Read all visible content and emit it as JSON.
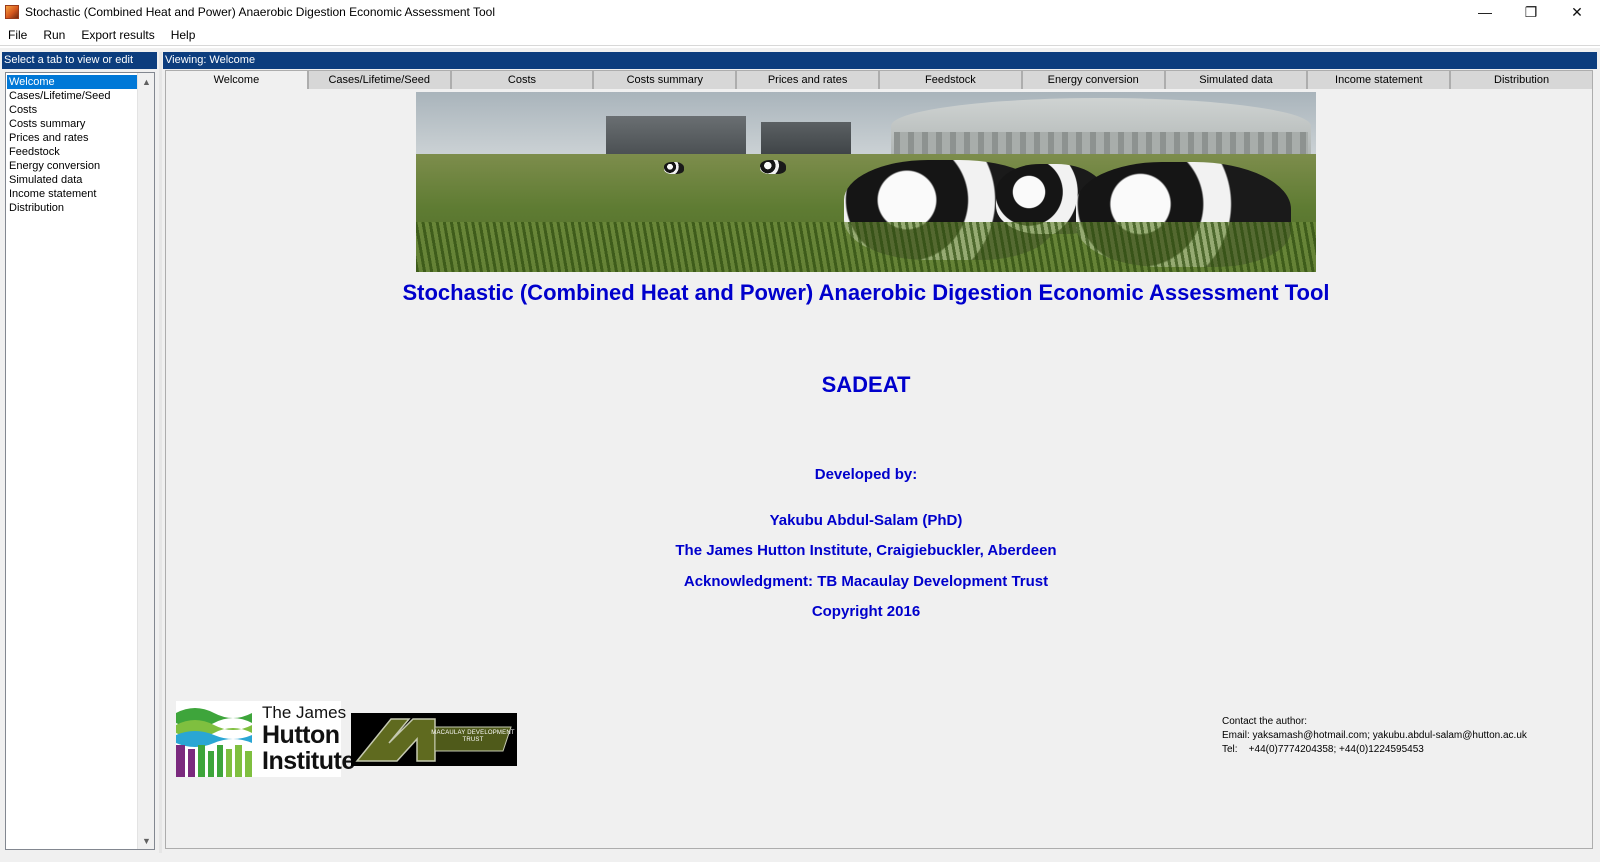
{
  "window": {
    "title": "Stochastic (Combined Heat and Power) Anaerobic Digestion Economic Assessment Tool",
    "controls": {
      "minimize": "—",
      "restore": "❐",
      "close": "✕"
    }
  },
  "menu": [
    "File",
    "Run",
    "Export results",
    "Help"
  ],
  "sidebar": {
    "header": "Select a tab to view or edit",
    "items": [
      "Welcome",
      "Cases/Lifetime/Seed",
      "Costs",
      "Costs summary",
      "Prices and rates",
      "Feedstock",
      "Energy conversion",
      "Simulated data",
      "Income statement",
      "Distribution"
    ],
    "selected_index": 0
  },
  "viewing": "Viewing: Welcome",
  "tabs": [
    "Welcome",
    "Cases/Lifetime/Seed",
    "Costs",
    "Costs summary",
    "Prices and rates",
    "Feedstock",
    "Energy conversion",
    "Simulated data",
    "Income statement",
    "Distribution"
  ],
  "active_tab": "Welcome",
  "welcome": {
    "title": "Stochastic (Combined Heat and Power) Anaerobic Digestion Economic Assessment Tool",
    "acronym": "SADEAT",
    "developed_by": "Developed by:",
    "author": "Yakubu Abdul-Salam (PhD)",
    "institution": "The James Hutton Institute, Craigiebuckler, Aberdeen",
    "acknowledgment": "Acknowledgment: TB Macaulay Development Trust",
    "copyright": "Copyright 2016",
    "text_color": "#0000CC"
  },
  "logos": {
    "hutton": {
      "line1": "The James",
      "line2": "Hutton",
      "line3": "Institute"
    },
    "macaulay": {
      "line1": "MACAULAY DEVELOPMENT",
      "line2": "TRUST"
    }
  },
  "contact": {
    "heading": "Contact the author:",
    "email": "Email: yaksamash@hotmail.com; yakubu.abdul-salam@hutton.ac.uk",
    "tel": "Tel:    +44(0)7774204358; +44(0)1224595453"
  },
  "colors": {
    "header_bg": "#0C3D7E",
    "selection": "#0078D7"
  }
}
